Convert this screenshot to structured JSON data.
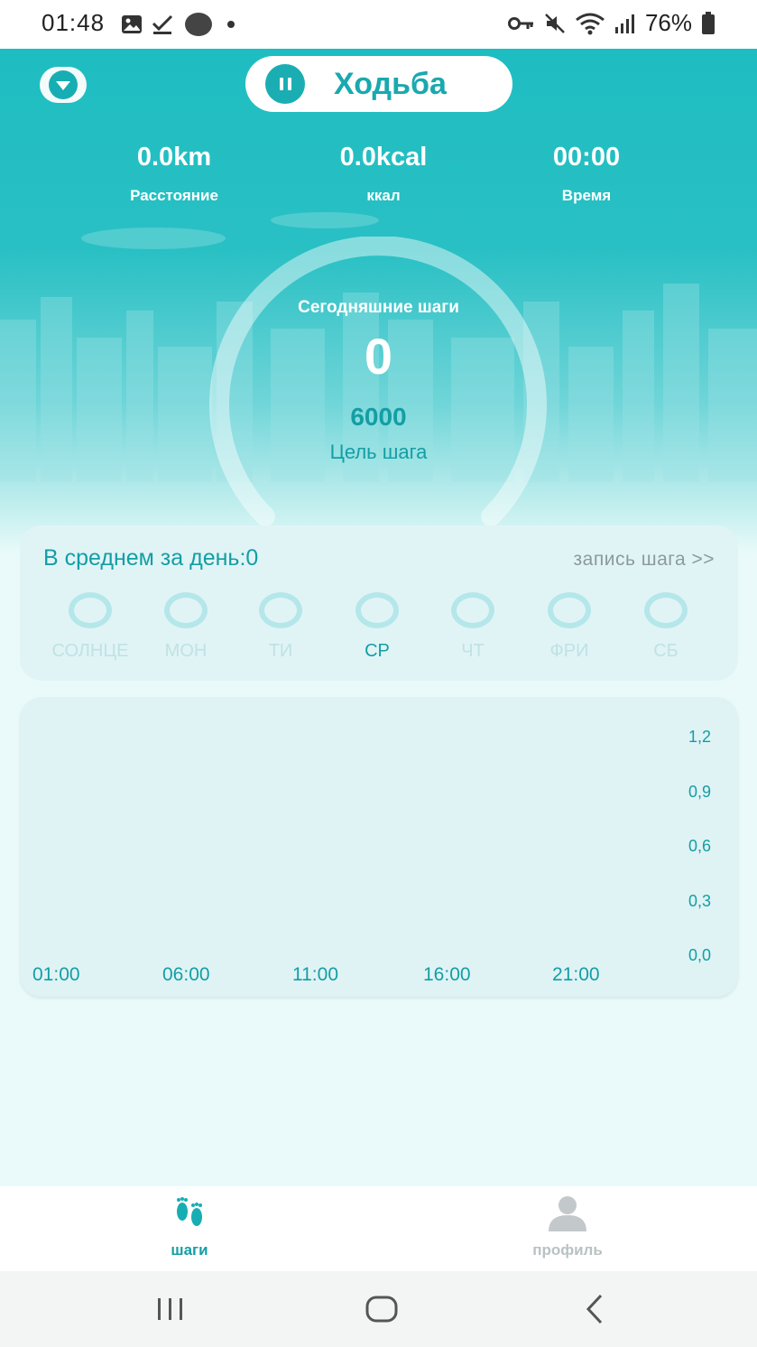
{
  "status_bar": {
    "time": "01:48",
    "battery": "76%",
    "icons": [
      "image-icon",
      "check-icon",
      "circle-icon",
      "dot-icon",
      "key-icon",
      "mute-icon",
      "wifi-icon",
      "signal-icon",
      "battery-icon"
    ]
  },
  "header": {
    "mode_label": "Ходьба"
  },
  "stats": [
    {
      "value": "0.0km",
      "label": "Расстояние"
    },
    {
      "value": "0.0kcal",
      "label": "ккал"
    },
    {
      "value": "00:00",
      "label": "Время"
    }
  ],
  "steps_ring": {
    "title": "Сегодняшние шаги",
    "steps": "0",
    "goal": "6000",
    "goal_label": "Цель шага",
    "progress": 0
  },
  "week": {
    "average": "В среднем за день:0",
    "record_link": "запись шага >>",
    "days": [
      {
        "label": "СОЛНЦЕ",
        "active": false
      },
      {
        "label": "МОН",
        "active": false
      },
      {
        "label": "ТИ",
        "active": false
      },
      {
        "label": "СР",
        "active": true
      },
      {
        "label": "ЧТ",
        "active": false
      },
      {
        "label": "ФРИ",
        "active": false
      },
      {
        "label": "СБ",
        "active": false
      }
    ]
  },
  "chart_data": {
    "type": "bar",
    "x": [
      "01:00",
      "06:00",
      "11:00",
      "16:00",
      "21:00"
    ],
    "y_ticks": [
      "1,2",
      "0,9",
      "0,6",
      "0,3",
      "0,0"
    ],
    "ylim": [
      0,
      1.2
    ],
    "values": []
  },
  "bottom_nav": {
    "steps_label": "шаги",
    "profile_label": "профиль"
  },
  "colors": {
    "accent": "#19a9ae",
    "header_top": "#1ebdc1",
    "inactive": "#b9c2c3"
  }
}
